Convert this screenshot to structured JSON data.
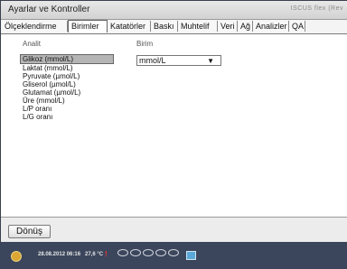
{
  "window": {
    "title": "Ayarlar ve Kontroller",
    "brand": "ISCUS flex (Rev"
  },
  "tabs": [
    {
      "label": "Ölçeklendirme",
      "active": false
    },
    {
      "label": "Birimler",
      "active": true
    },
    {
      "label": "Katatörler",
      "active": false
    },
    {
      "label": "Baskı",
      "active": false
    },
    {
      "label": "Muhtelif",
      "active": false
    },
    {
      "label": "Veri",
      "active": false
    },
    {
      "label": "Ağ",
      "active": false
    },
    {
      "label": "Analizler",
      "active": false
    },
    {
      "label": "QA",
      "active": false
    }
  ],
  "analyte": {
    "header": "Analit",
    "items": [
      "Glikoz (mmol/L)",
      "Laktat (mmol/L)",
      "Pyruvate (µmol/L)",
      "Gliserol (µmol/L)",
      "Glutamat (µmol/L)",
      "Üre (mmol/L)",
      "L/P oranı",
      "L/G oranı"
    ],
    "selected": "Glikoz (mmol/L)"
  },
  "unit": {
    "header": "Birim",
    "value": "mmol/L",
    "arrow": "▼"
  },
  "footer": {
    "back_label": "Dönüş"
  },
  "status": {
    "datetime": "28.08.2012 06:16",
    "temperature": "27,6 °C",
    "alert": "!"
  }
}
